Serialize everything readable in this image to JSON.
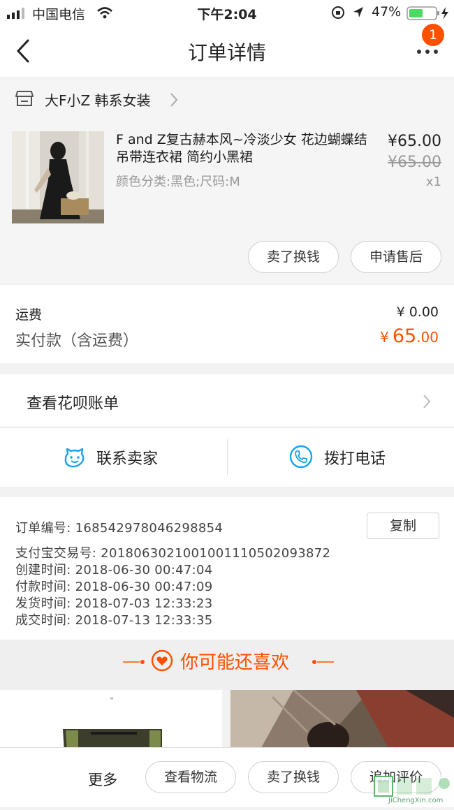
{
  "status_bar": {
    "carrier": "中国电信",
    "time": "下午2:04",
    "battery": "47%"
  },
  "nav": {
    "title": "订单详情",
    "badge_count": "1"
  },
  "shop": {
    "name": "大F小Z 韩系女装"
  },
  "product": {
    "title": "F and Z复古赫本风~冷淡少女 花边蝴蝶结吊带连衣裙 简约小黑裙",
    "attributes": "颜色分类:黑色;尺码:M",
    "price": "¥65.00",
    "original_price": "¥65.00",
    "quantity": "x1",
    "actions": [
      "卖了换钱",
      "申请售后"
    ]
  },
  "fees": {
    "shipping_label": "运费",
    "shipping_value": "¥ 0.00",
    "paid_label": "实付款（含运费）",
    "paid_symbol": "¥",
    "paid_int": "65",
    "paid_dec": ".00"
  },
  "huabei": {
    "label": "查看花呗账单"
  },
  "contact": {
    "seller": "联系卖家",
    "phone": "拨打电话"
  },
  "order_info": {
    "copy_label": "复制",
    "lines": [
      "订单编号:   168542978046298854",
      "支付宝交易号:   2018063021001001110502093872",
      "创建时间:   2018-06-30 00:47:04",
      "付款时间:   2018-06-30 00:47:09",
      "发货时间:   2018-07-03 12:33:23",
      "成交时间:   2018-07-13 12:33:35"
    ]
  },
  "recommend": {
    "title": "你可能还喜欢"
  },
  "bottom_bar": {
    "more": "更多",
    "buttons": [
      "查看物流",
      "卖了换钱",
      "追加评价"
    ]
  },
  "watermark": {
    "text": "JiChengXin.com"
  },
  "colors": {
    "accent": "#ff5000",
    "contact_icon": "#1aa3f0"
  }
}
